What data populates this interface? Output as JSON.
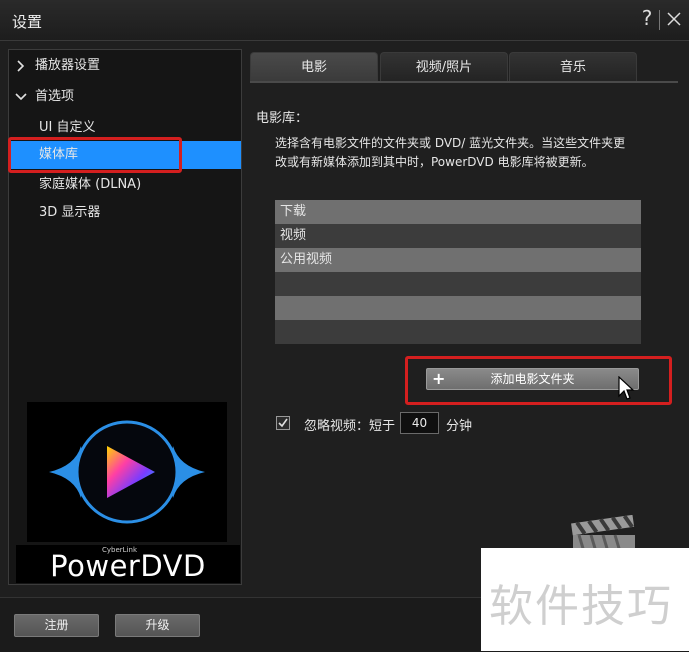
{
  "window": {
    "title": "设置",
    "help_label": "?"
  },
  "sidebar": {
    "groups": [
      {
        "label": "播放器设置",
        "expanded": false
      },
      {
        "label": "首选项",
        "expanded": true
      }
    ],
    "items": [
      {
        "label": "UI 自定义"
      },
      {
        "label": "媒体库",
        "selected": true
      },
      {
        "label": "家庭媒体 (DLNA)"
      },
      {
        "label": "3D 显示器"
      }
    ],
    "logo": {
      "brand_small": "CyberLink",
      "brand_big": "PowerDVD"
    }
  },
  "tabs": [
    {
      "label": "电影",
      "active": true
    },
    {
      "label": "视频/照片",
      "active": false
    },
    {
      "label": "音乐",
      "active": false
    }
  ],
  "content": {
    "section_label": "电影库：",
    "description_line1": "选择含有电影文件的文件夹或 DVD/ 蓝光文件夹。当这些文件夹更",
    "description_line2": "改或有新媒体添加到其中时，PowerDVD 电影库将被更新。",
    "folders": [
      "下载",
      "视频",
      "公用视频",
      "",
      "",
      ""
    ],
    "add_folder_label": "添加电影文件夹",
    "ignore_checked": true,
    "ignore_label": "忽略视频：短于",
    "ignore_minutes": "40",
    "minutes_unit": "分钟"
  },
  "footer": {
    "register_label": "注册",
    "upgrade_label": "升级"
  },
  "watermark": {
    "text": "软件技巧"
  },
  "colors": {
    "selection_blue": "#1e90ff",
    "highlight_red": "#d41f1f"
  }
}
